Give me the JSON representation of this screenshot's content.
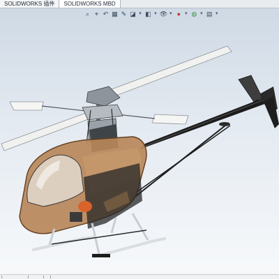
{
  "tabs": [
    {
      "label": "SOLIDWORKS 插件",
      "active": false
    },
    {
      "label": "SOLIDWORKS MBD",
      "active": true
    }
  ],
  "heads_up_toolbar": [
    {
      "name": "zoom-to-fit-icon",
      "glyph": "⌕"
    },
    {
      "name": "zoom-to-area-icon",
      "glyph": "⌖"
    },
    {
      "name": "previous-view-icon",
      "glyph": "↶"
    },
    {
      "name": "section-view-icon",
      "glyph": "▦"
    },
    {
      "name": "dynamic-annotation-icon",
      "glyph": "✎"
    },
    {
      "name": "view-orientation-icon",
      "glyph": "◪"
    },
    {
      "name": "display-style-icon",
      "glyph": "◧"
    },
    {
      "name": "hide-show-items-icon",
      "glyph": "👁"
    },
    {
      "name": "edit-appearance-icon",
      "glyph": "●"
    },
    {
      "name": "apply-scene-icon",
      "glyph": "◍"
    },
    {
      "name": "view-settings-icon",
      "glyph": "▤"
    }
  ],
  "colors": {
    "canopy": "#b8875a",
    "frame": "#1c1c1c",
    "blade": "#f1f2ef",
    "skid": "#d9dde1",
    "viewport_top": "#cdd8e4",
    "viewport_bottom": "#f7f9fb"
  }
}
